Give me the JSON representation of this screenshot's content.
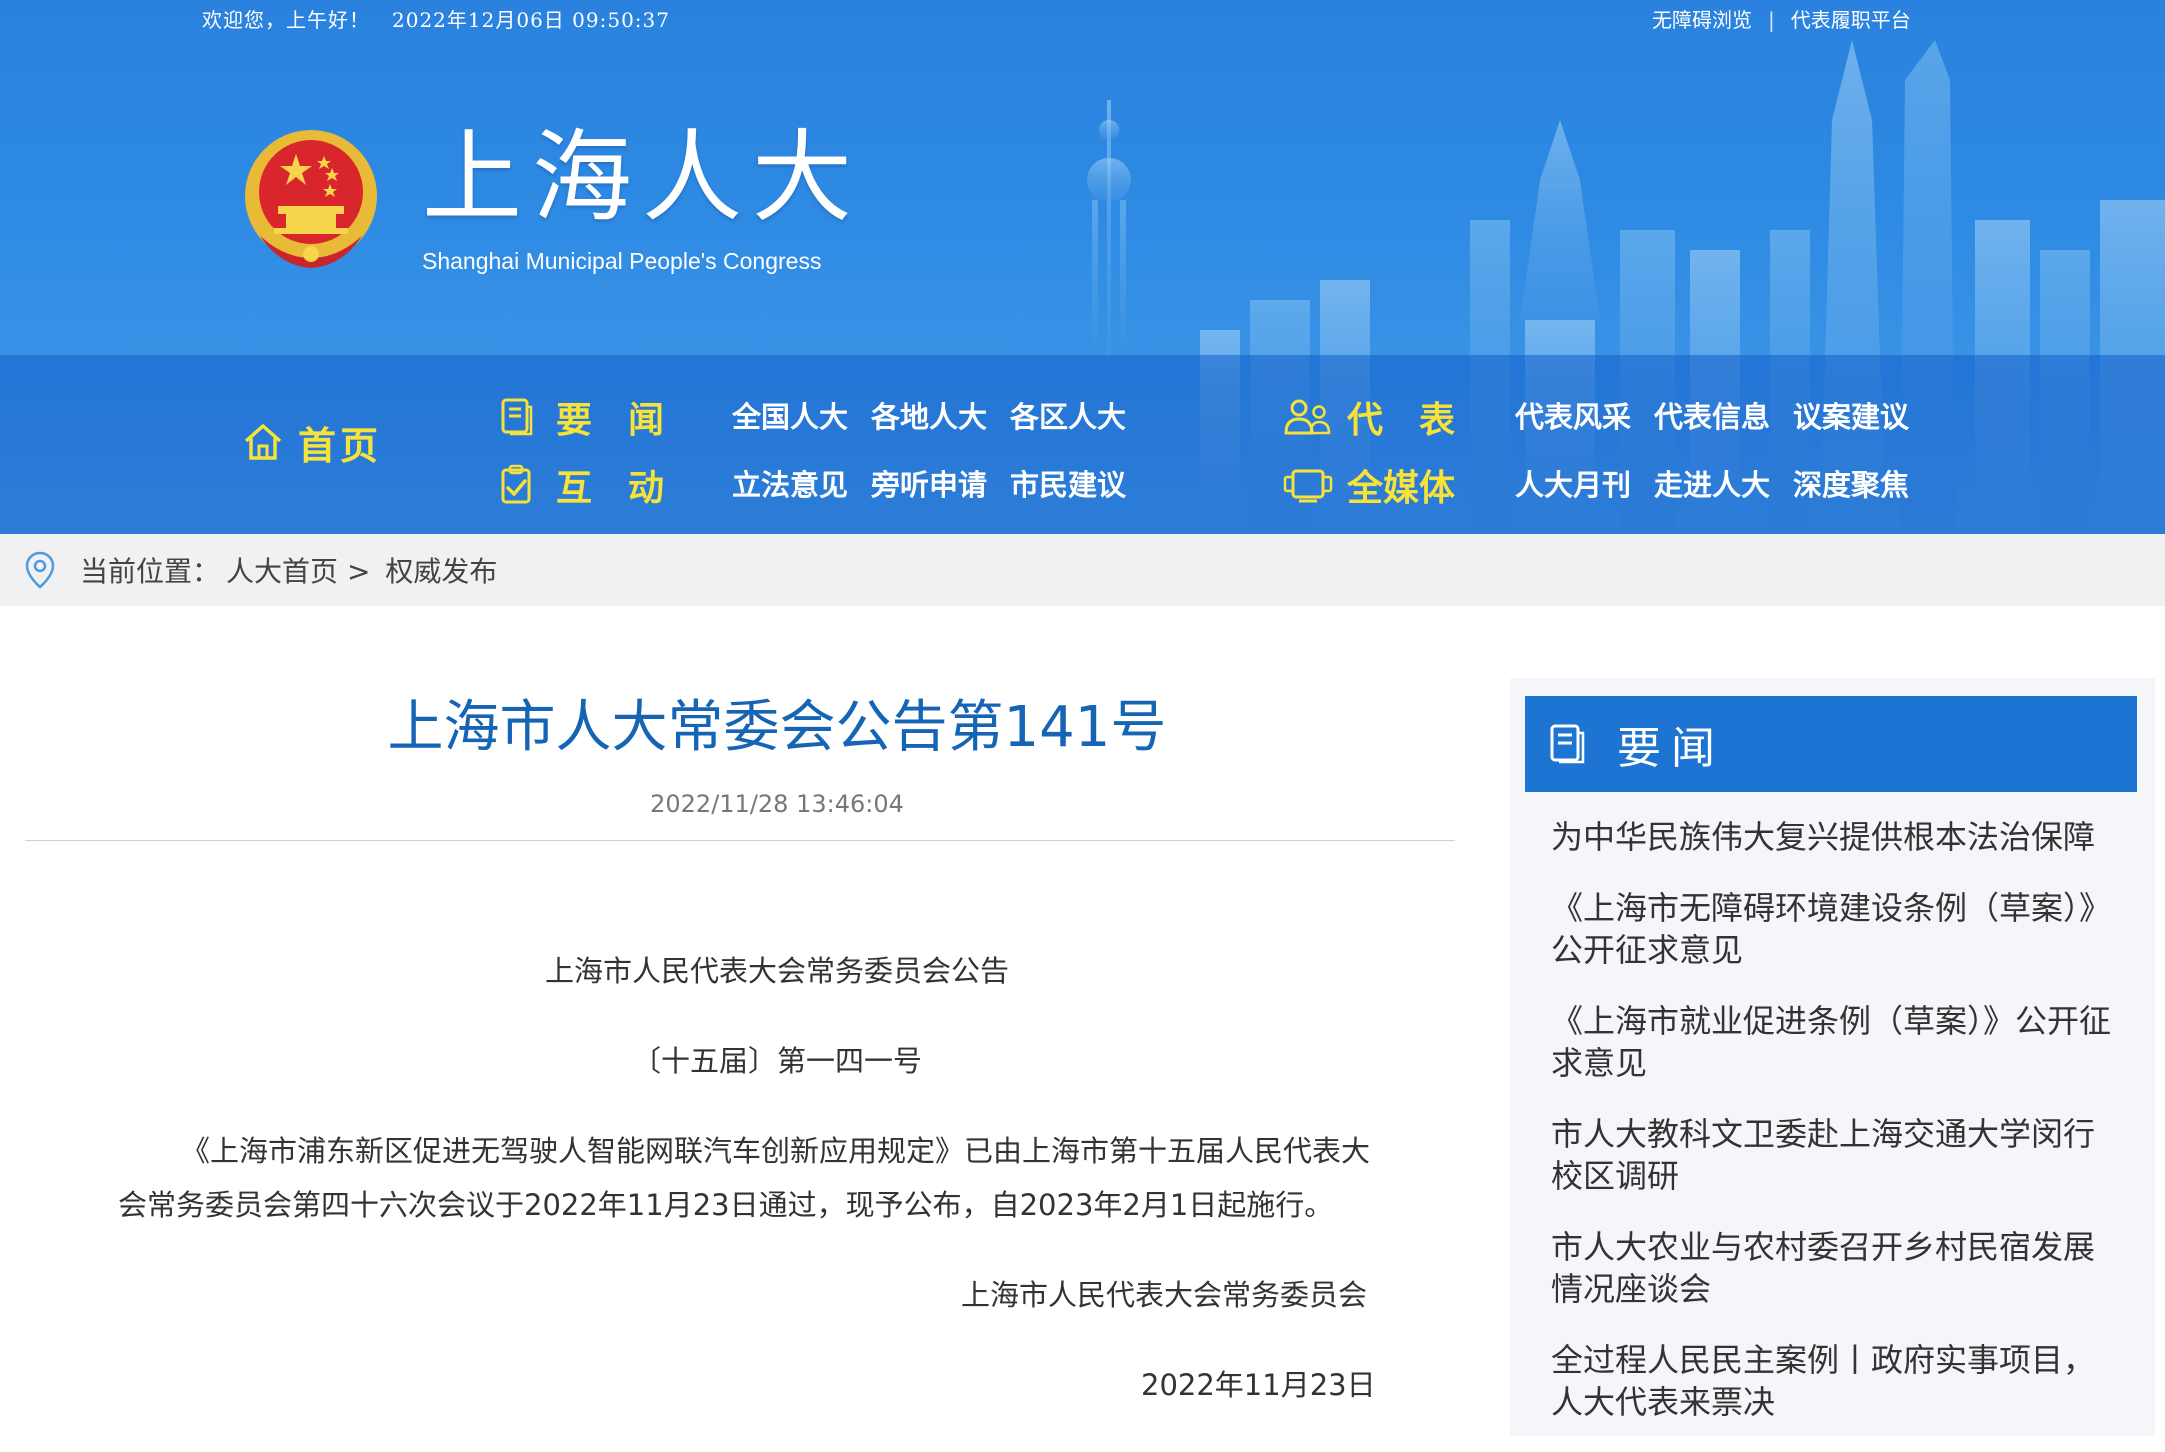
{
  "topbar": {
    "greeting": "欢迎您，上午好！",
    "datetime": "2022年12月06日 09:50:37",
    "links": [
      "无障碍浏览",
      "代表履职平台"
    ],
    "separator": "|"
  },
  "site": {
    "title": "上海人大",
    "subtitle": "Shanghai Municipal People's Congress"
  },
  "nav": {
    "home": "首页",
    "sections": [
      {
        "label": "要　闻",
        "icon": "document-icon",
        "links": [
          "全国人大",
          "各地人大",
          "各区人大"
        ]
      },
      {
        "label": "互　动",
        "icon": "checklist-icon",
        "links": [
          "立法意见",
          "旁听申请",
          "市民建议"
        ]
      },
      {
        "label": "代　表",
        "icon": "people-icon",
        "links": [
          "代表风采",
          "代表信息",
          "议案建议"
        ]
      },
      {
        "label": "全媒体",
        "icon": "media-icon",
        "links": [
          "人大月刊",
          "走进人大",
          "深度聚焦"
        ]
      }
    ]
  },
  "breadcrumb": {
    "prefix": "当前位置：",
    "home": "人大首页",
    "separator": ">",
    "current": "权威发布"
  },
  "article": {
    "title": "上海市人大常委会公告第141号",
    "date": "2022/11/28 13:46:04",
    "heading": "上海市人民代表大会常务委员会公告",
    "number": "〔十五届〕第一四一号",
    "body_line1": "《上海市浦东新区促进无驾驶人智能网联汽车创新应用规定》已由上海市第十五届人民代表大",
    "body_line2": "会常务委员会第四十六次会议于2022年11月23日通过，现予公布，自2023年2月1日起施行。",
    "signature": "上海市人民代表大会常务委员会",
    "sign_date": "2022年11月23日"
  },
  "sidebar": {
    "heading": "要闻",
    "items": [
      "为中华民族伟大复兴提供根本法治保障",
      "《上海市无障碍环境建设条例（草案）》公开征求意见",
      "《上海市就业促进条例（草案）》公开征求意见",
      "市人大教科文卫委赴上海交通大学闵行校区调研",
      "市人大农业与农村委召开乡村民宿发展情况座谈会",
      "全过程人民民主案例丨政府实事项目，人大代表来票决"
    ]
  },
  "colors": {
    "banner_blue": "#2e8ae3",
    "nav_yellow": "#f7e23a",
    "title_blue": "#1665b5",
    "side_head_blue": "#1e74d2"
  }
}
